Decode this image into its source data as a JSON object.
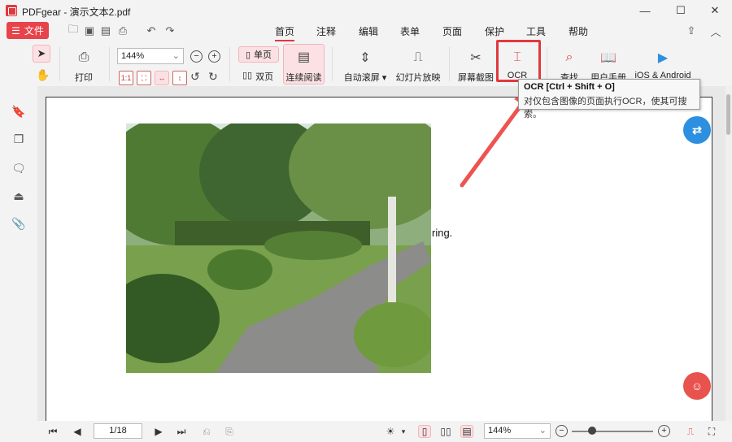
{
  "window": {
    "title": "PDFgear - 演示文本2.pdf",
    "minimize_icon": "minimize-icon",
    "maximize_icon": "maximize-icon",
    "close_icon": "close-icon"
  },
  "menubar": {
    "file_label": "文件",
    "tabs": [
      {
        "label": "首页",
        "active": true
      },
      {
        "label": "注释",
        "active": false
      },
      {
        "label": "编辑",
        "active": false
      },
      {
        "label": "表单",
        "active": false
      },
      {
        "label": "页面",
        "active": false
      },
      {
        "label": "保护",
        "active": false
      },
      {
        "label": "工具",
        "active": false
      },
      {
        "label": "帮助",
        "active": false
      }
    ]
  },
  "ribbon": {
    "print_label": "打印",
    "zoom_value": "144%",
    "single_page_label": "单页",
    "double_page_label": "双页",
    "continuous_label": "连续阅读",
    "auto_scroll_label": "自动滚屏",
    "slideshow_label": "幻灯片放映",
    "screenshot_label": "屏幕截图",
    "ocr_label": "OCR",
    "find_label": "查找",
    "manual_label": "用户手册",
    "mobile_label": "iOS & Android"
  },
  "tooltip": {
    "title": "OCR  [Ctrl + Shift + O]",
    "description": "对仅包含图像的页面执行OCR，使其可搜索。"
  },
  "document": {
    "visible_text": "ring."
  },
  "statusbar": {
    "page_display": "1/18",
    "zoom_value": "144%",
    "zoom_level": 0.25
  },
  "colors": {
    "accent": "#e0393e",
    "accent_light": "#fbe1e3",
    "translate_button": "#2d8fe0",
    "assistant_button": "#e8534e"
  }
}
